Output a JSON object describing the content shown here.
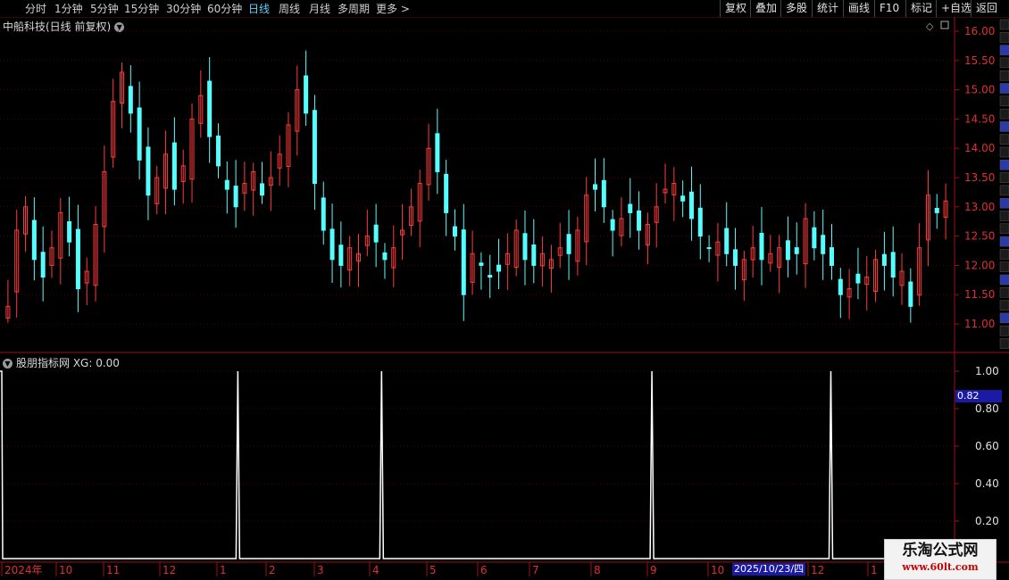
{
  "toolbar": {
    "periods": [
      "分时",
      "1分钟",
      "5分钟",
      "15分钟",
      "30分钟",
      "60分钟",
      "日线",
      "周线",
      "月线",
      "多周期",
      "更多 >"
    ],
    "active_period": "日线",
    "actions": [
      "复权",
      "叠加",
      "多股",
      "统计",
      "画线",
      "F10",
      "标记",
      "+自选",
      "返回"
    ]
  },
  "main_chart": {
    "title": "中船科技(日线 前复权)",
    "y_ticks": [
      "16.00",
      "15.50",
      "15.00",
      "14.50",
      "14.00",
      "13.50",
      "13.00",
      "12.50",
      "12.00",
      "11.50",
      "11.00"
    ],
    "corner_icons": [
      "diamond-icon",
      "square-icon"
    ]
  },
  "indicator": {
    "title": "股朋指标网 XG: 0.00",
    "y_ticks": [
      "1.00",
      "0.80",
      "0.60",
      "0.40",
      "0.20"
    ],
    "cursor_value": "0.82",
    "signal_dates_note": ""
  },
  "x_axis": {
    "labels": [
      "2024年",
      "10",
      "11",
      "12",
      "1",
      "2",
      "3",
      "4",
      "5",
      "6",
      "7",
      "8",
      "9",
      "10",
      "12",
      "1"
    ],
    "selected_date": "2025/10/23/四"
  },
  "watermark": {
    "title": "乐淘公式网",
    "url": "www.60lt.com"
  },
  "colors": {
    "up": "#ff3c3c",
    "down": "#54ffff",
    "axis_red": "#a01010",
    "grid": "#5a0000",
    "signal": "#ffffff",
    "active_tab": "#5ad2ff"
  },
  "chart_data": {
    "type": "candlestick",
    "price_range": [
      10.8,
      16.1
    ],
    "closes": [
      11.3,
      12.6,
      13.0,
      12.1,
      11.8,
      12.3,
      12.9,
      12.4,
      11.6,
      11.9,
      12.7,
      13.6,
      14.8,
      15.3,
      14.6,
      13.8,
      13.2,
      13.5,
      13.9,
      13.3,
      13.7,
      14.5,
      14.9,
      14.2,
      13.7,
      13.3,
      13.0,
      13.4,
      13.6,
      13.2,
      13.5,
      13.9,
      14.4,
      15.0,
      14.6,
      13.4,
      12.6,
      12.1,
      12.0,
      12.3,
      12.2,
      12.5,
      12.4,
      12.1,
      12.3,
      12.6,
      13.0,
      13.4,
      14.0,
      13.6,
      12.9,
      12.5,
      11.5,
      12.2,
      12.0,
      11.8,
      11.9,
      12.2,
      12.6,
      12.1,
      12.0,
      12.2,
      12.1,
      12.3,
      12.2,
      12.6,
      13.2,
      13.3,
      13.0,
      12.6,
      12.8,
      12.9,
      12.6,
      12.7,
      13.0,
      13.3,
      13.4,
      13.1,
      12.8,
      12.5,
      12.3,
      12.4,
      12.2,
      12.0,
      12.1,
      12.3,
      12.1,
      12.2,
      12.3,
      12.1,
      12.2,
      12.8,
      12.3,
      12.2,
      12.0,
      11.5,
      11.6,
      11.7,
      11.8,
      12.1,
      12.0,
      11.8,
      11.9,
      11.3,
      12.3,
      13.2,
      12.9,
      13.1
    ],
    "signals_x_fraction": [
      0.0,
      0.248,
      0.399,
      0.683,
      0.871
    ]
  }
}
